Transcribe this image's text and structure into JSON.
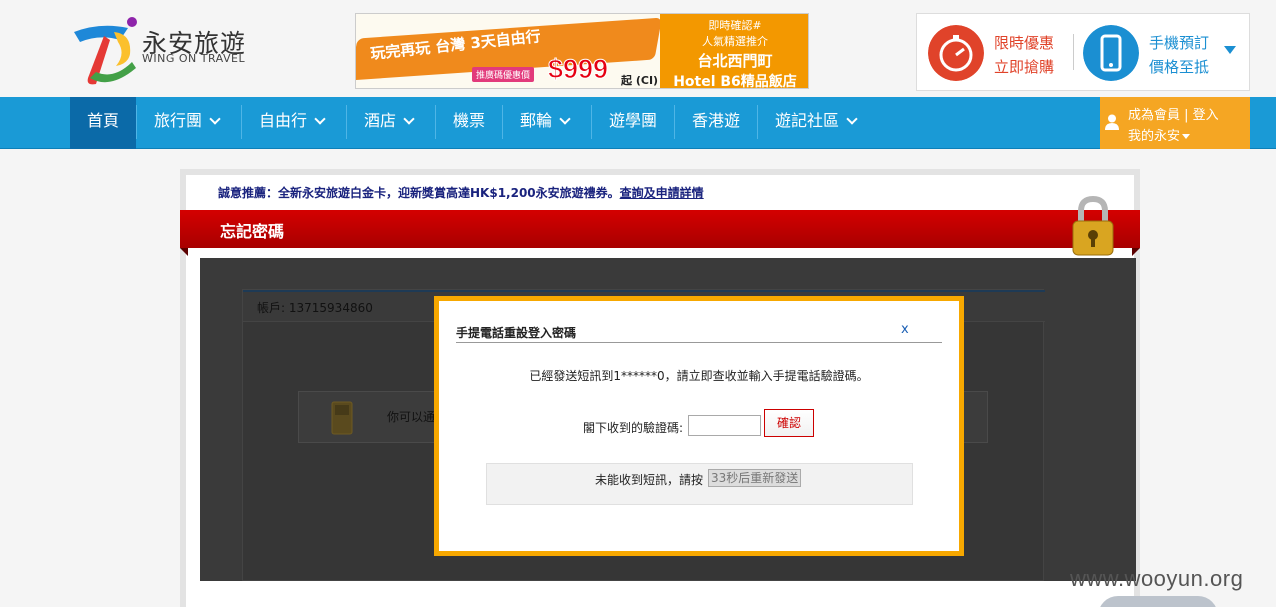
{
  "header": {
    "logo_cn": "永安旅遊",
    "logo_en": "WING ON TRAVEL",
    "banner": {
      "slogan": "玩完再玩 台灣 3天自由行",
      "promo_label": "推廣碼優惠價",
      "price": "$999",
      "price_suffix": "起",
      "price_note": "(CI)",
      "right_line1": "即時確認#",
      "right_line2": "人氣精選推介",
      "right_line3": "台北西門町",
      "right_line4": "Hotel B6精品飯店"
    },
    "promo1_line1": "限時優惠",
    "promo1_line2": "立即搶購",
    "promo2_line1": "手機預訂",
    "promo2_line2": "價格至抵"
  },
  "nav": {
    "items": [
      "首頁",
      "旅行團",
      "自由行",
      "酒店",
      "機票",
      "郵輪",
      "遊學團",
      "香港遊",
      "遊記社區"
    ],
    "user_line1": "成為會員 | 登入",
    "user_line2": "我的永安"
  },
  "content": {
    "notice_text": "誠意推薦：全新永安旅遊白金卡，迎新獎賞高達HK$1,200永安旅遊禮券。",
    "notice_link": "查詢及申請詳情",
    "section_title": "忘記密碼",
    "account_label": "帳戶:",
    "account_value": "13715934860",
    "inner_text": "你可以通"
  },
  "modal": {
    "title": "手提電話重設登入密碼",
    "close": "x",
    "message": "已經發送短訊到1******0，請立即查收並輸入手提電話驗證碼。",
    "code_label": "閣下收到的驗證碼:",
    "code_value": "",
    "confirm": "確認",
    "resend_text": "未能收到短訊，請按",
    "resend_button": "33秒后重新發送"
  },
  "watermark": "www.wooyun.org",
  "colors": {
    "nav_blue": "#1a9ad6",
    "nav_active": "#0b6aa8",
    "user_orange": "#f5a623",
    "red_bar": "#c00000",
    "modal_border": "#f7a800",
    "promo_red": "#e0432a",
    "promo_blue": "#1b8fd2"
  }
}
